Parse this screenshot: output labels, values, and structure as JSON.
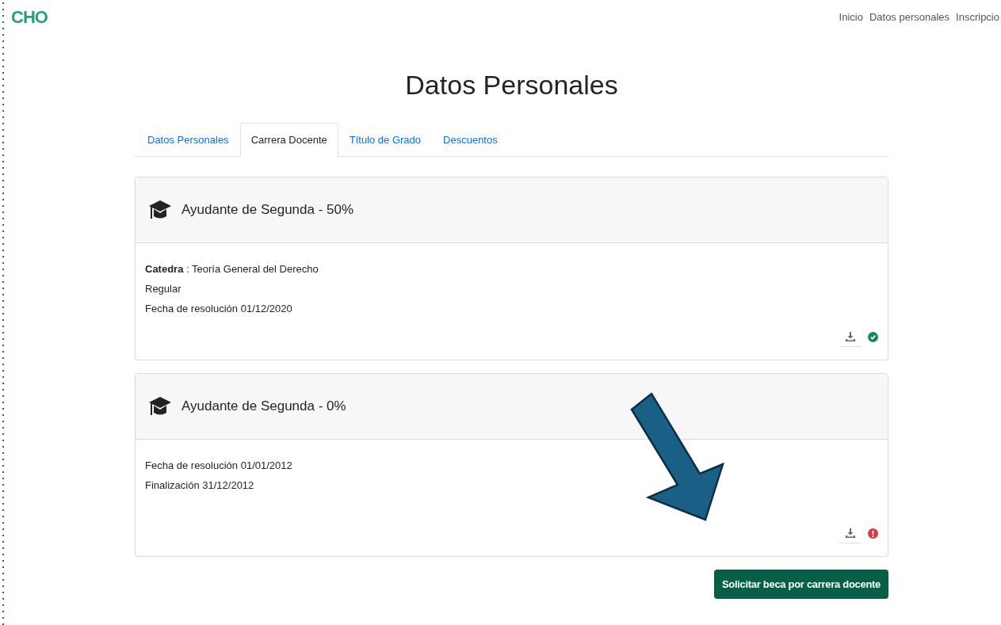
{
  "brand": "CHO",
  "nav": [
    "Inicio",
    "Datos personales",
    "Inscripcio"
  ],
  "title": "Datos Personales",
  "tabs": [
    {
      "label": "Datos Personales",
      "selected": false
    },
    {
      "label": "Carrera Docente",
      "selected": true
    },
    {
      "label": "Título de Grado",
      "selected": false
    },
    {
      "label": "Descuentos",
      "selected": false
    }
  ],
  "cards": [
    {
      "heading": "Ayudante de Segunda - 50%",
      "lines": [
        "**Catedra** : Teoría General del Derecho",
        "Regular",
        "Fecha de resolución 01/12/2020"
      ],
      "approved": true
    },
    {
      "heading": "Ayudante de Segunda - 0%",
      "lines": [
        "Fecha de resolución 01/01/2012",
        "Finalización 31/12/2012"
      ],
      "approved": false
    }
  ],
  "action_button": "Solicitar beca por carrera docente"
}
